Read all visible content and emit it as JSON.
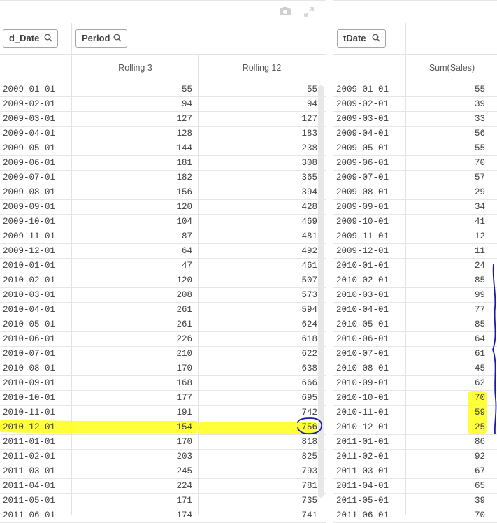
{
  "left_table": {
    "filters": [
      {
        "label": "d_Date"
      },
      {
        "label": "Period"
      }
    ],
    "column_headers": [
      "Rolling 3",
      "Rolling 12"
    ],
    "rows": [
      {
        "date": "2009-01-01",
        "r3": "55",
        "r12": "55"
      },
      {
        "date": "2009-02-01",
        "r3": "94",
        "r12": "94"
      },
      {
        "date": "2009-03-01",
        "r3": "127",
        "r12": "127"
      },
      {
        "date": "2009-04-01",
        "r3": "128",
        "r12": "183"
      },
      {
        "date": "2009-05-01",
        "r3": "144",
        "r12": "238"
      },
      {
        "date": "2009-06-01",
        "r3": "181",
        "r12": "308"
      },
      {
        "date": "2009-07-01",
        "r3": "182",
        "r12": "365"
      },
      {
        "date": "2009-08-01",
        "r3": "156",
        "r12": "394"
      },
      {
        "date": "2009-09-01",
        "r3": "120",
        "r12": "428"
      },
      {
        "date": "2009-10-01",
        "r3": "104",
        "r12": "469"
      },
      {
        "date": "2009-11-01",
        "r3": "87",
        "r12": "481"
      },
      {
        "date": "2009-12-01",
        "r3": "64",
        "r12": "492"
      },
      {
        "date": "2010-01-01",
        "r3": "47",
        "r12": "461"
      },
      {
        "date": "2010-02-01",
        "r3": "120",
        "r12": "507"
      },
      {
        "date": "2010-03-01",
        "r3": "208",
        "r12": "573"
      },
      {
        "date": "2010-04-01",
        "r3": "261",
        "r12": "594"
      },
      {
        "date": "2010-05-01",
        "r3": "261",
        "r12": "624"
      },
      {
        "date": "2010-06-01",
        "r3": "226",
        "r12": "618"
      },
      {
        "date": "2010-07-01",
        "r3": "210",
        "r12": "622"
      },
      {
        "date": "2010-08-01",
        "r3": "170",
        "r12": "638"
      },
      {
        "date": "2010-09-01",
        "r3": "168",
        "r12": "666"
      },
      {
        "date": "2010-10-01",
        "r3": "177",
        "r12": "695"
      },
      {
        "date": "2010-11-01",
        "r3": "191",
        "r12": "742"
      },
      {
        "date": "2010-12-01",
        "r3": "154",
        "r12": "756"
      },
      {
        "date": "2011-01-01",
        "r3": "170",
        "r12": "818"
      },
      {
        "date": "2011-02-01",
        "r3": "203",
        "r12": "825"
      },
      {
        "date": "2011-03-01",
        "r3": "245",
        "r12": "793"
      },
      {
        "date": "2011-04-01",
        "r3": "224",
        "r12": "781"
      },
      {
        "date": "2011-05-01",
        "r3": "171",
        "r12": "735"
      },
      {
        "date": "2011-06-01",
        "r3": "174",
        "r12": "741"
      }
    ]
  },
  "right_table": {
    "filters": [
      {
        "label": "tDate"
      }
    ],
    "column_headers": [
      "Sum(Sales)"
    ],
    "rows": [
      {
        "date": "2009-01-01",
        "sales": "55"
      },
      {
        "date": "2009-02-01",
        "sales": "39"
      },
      {
        "date": "2009-03-01",
        "sales": "33"
      },
      {
        "date": "2009-04-01",
        "sales": "56"
      },
      {
        "date": "2009-05-01",
        "sales": "55"
      },
      {
        "date": "2009-06-01",
        "sales": "70"
      },
      {
        "date": "2009-07-01",
        "sales": "57"
      },
      {
        "date": "2009-08-01",
        "sales": "29"
      },
      {
        "date": "2009-09-01",
        "sales": "34"
      },
      {
        "date": "2009-10-01",
        "sales": "41"
      },
      {
        "date": "2009-11-01",
        "sales": "12"
      },
      {
        "date": "2009-12-01",
        "sales": "11"
      },
      {
        "date": "2010-01-01",
        "sales": "24"
      },
      {
        "date": "2010-02-01",
        "sales": "85"
      },
      {
        "date": "2010-03-01",
        "sales": "99"
      },
      {
        "date": "2010-04-01",
        "sales": "77"
      },
      {
        "date": "2010-05-01",
        "sales": "85"
      },
      {
        "date": "2010-06-01",
        "sales": "64"
      },
      {
        "date": "2010-07-01",
        "sales": "61"
      },
      {
        "date": "2010-08-01",
        "sales": "45"
      },
      {
        "date": "2010-09-01",
        "sales": "62"
      },
      {
        "date": "2010-10-01",
        "sales": "70"
      },
      {
        "date": "2010-11-01",
        "sales": "59"
      },
      {
        "date": "2010-12-01",
        "sales": "25"
      },
      {
        "date": "2011-01-01",
        "sales": "86"
      },
      {
        "date": "2011-02-01",
        "sales": "92"
      },
      {
        "date": "2011-03-01",
        "sales": "67"
      },
      {
        "date": "2011-04-01",
        "sales": "65"
      },
      {
        "date": "2011-05-01",
        "sales": "39"
      },
      {
        "date": "2011-06-01",
        "sales": "70"
      }
    ]
  },
  "toolbar_icons": [
    "camera-icon",
    "expand-icon"
  ],
  "colors": {
    "highlight": "#ffff29",
    "annotation_ink": "#1a1aa6",
    "grid_line": "#e6e6e6",
    "text": "#404040"
  }
}
